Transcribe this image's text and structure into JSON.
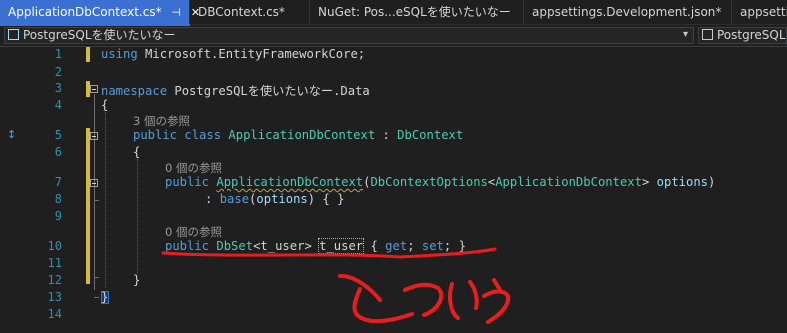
{
  "tabs": [
    {
      "label": "ApplicationDbContext.cs*"
    },
    {
      "label": "DBContext.cs*"
    },
    {
      "label": "NuGet: Pos...eSQLを使いたいなー"
    },
    {
      "label": "appsettings.Development.json*"
    },
    {
      "label": "appsettin"
    }
  ],
  "navbar": {
    "project": "PostgreSQLを使いたいなー",
    "scope": "PostgreSQLを使いた"
  },
  "line_numbers": [
    "1",
    "2",
    "3",
    "4",
    "5",
    "6",
    "7",
    "8",
    "9",
    "10",
    "11",
    "12",
    "13",
    "14"
  ],
  "code": {
    "l1": {
      "kw": "using",
      "text": " Microsoft.EntityFrameworkCore;"
    },
    "l3": {
      "kw": "namespace",
      "text": " PostgreSQLを使いたいなー.Data"
    },
    "l4": "{",
    "lens5": "3 個の参照",
    "l5": {
      "kw1": "public",
      "kw2": "class",
      "type": "ApplicationDbContext",
      "colon": " : ",
      "base": "DbContext"
    },
    "l6": "{",
    "lens7": "0 個の参照",
    "l7": {
      "kw": "public",
      "name": "ApplicationDbContext",
      "open": "(",
      "t1": "DbContextOptions",
      "lt": "<",
      "t2": "ApplicationDbContext",
      "gt": "> ",
      "param": "options",
      "close": ")"
    },
    "l8": {
      "pre": ": ",
      "kw": "base",
      "open": "(",
      "param": "options",
      "post": ") { }"
    },
    "lens10": "0 個の参照",
    "l10": {
      "kw": "public",
      "type": "DbSet",
      "lt": "<",
      "generic": "t_user",
      "gt": "> ",
      "name": "t_user",
      "open": " { ",
      "get": "get",
      "semi1": "; ",
      "set": "set",
      "close": "; }"
    },
    "l12": "}",
    "l13": "}"
  },
  "annotation": {
    "handwriting": "ついか",
    "color": "#e81e1e"
  },
  "colors": {
    "keyword": "#569cd6",
    "type": "#4ec9b0",
    "parameter": "#9cdcfe",
    "line_number": "#2b91af",
    "tab_active": "#3b6fd1",
    "change_bar": "#d7ba3b"
  }
}
